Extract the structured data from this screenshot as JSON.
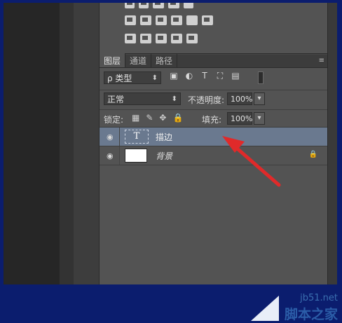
{
  "tabs": [
    "图层",
    "通道",
    "路径"
  ],
  "panel_menu": "≡",
  "filter": {
    "label": "ρ 类型",
    "icons": [
      "▣",
      "◐",
      "T",
      "⛶",
      "▤"
    ]
  },
  "blend": {
    "mode": "正常",
    "opacity_label": "不透明度:",
    "opacity_value": "100%"
  },
  "lock": {
    "label": "锁定:",
    "icons": [
      "▦",
      "✎",
      "✥",
      "🔒"
    ],
    "fill_label": "填充:",
    "fill_value": "100%"
  },
  "layers": [
    {
      "name": "描边",
      "type": "text",
      "selected": true,
      "visible": true,
      "thumb_glyph": "T"
    },
    {
      "name": "背景",
      "type": "background",
      "selected": false,
      "visible": true,
      "locked": true
    }
  ],
  "eye_glyph": "◉",
  "lock_glyph": "🔒",
  "chevron": "▾",
  "spin": "▾",
  "watermark": {
    "site": "jb51.net",
    "name": "脚本之家"
  },
  "colors": {
    "selected_row": "#6a798f",
    "arrow": "#e02a2a",
    "panel": "#535353"
  }
}
